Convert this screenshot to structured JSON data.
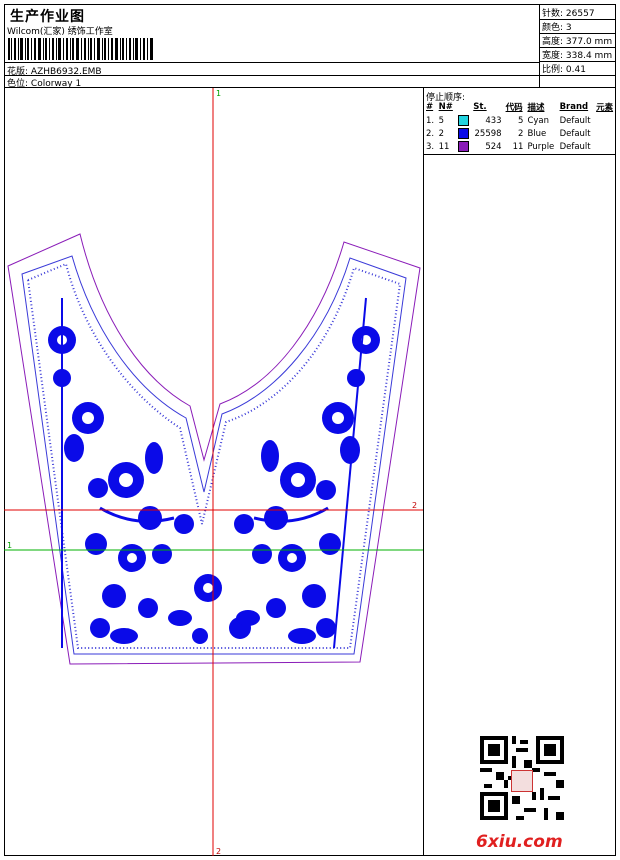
{
  "header": {
    "title": "生产作业图",
    "company": "Wilcom(汇家) 绣饰工作室",
    "design_label": "花版:",
    "design_value": "AZHB6932.EMB",
    "colorway_label": "色位:",
    "colorway_value": "Colorway 1"
  },
  "stats": [
    {
      "label": "针数:",
      "value": "26557"
    },
    {
      "label": "颜色:",
      "value": "3"
    },
    {
      "label": "高度:",
      "value": "377.0 mm"
    },
    {
      "label": "宽度:",
      "value": "338.4 mm"
    },
    {
      "label": "比例:",
      "value": "0.41"
    }
  ],
  "stop_sequence": {
    "title": "停止顺序:",
    "headers": [
      "#",
      "N#",
      "St.",
      "代码",
      "描述",
      "Brand",
      "元素"
    ],
    "rows": [
      {
        "idx": "1.",
        "n": "5",
        "color": "#22d3e0",
        "st": "433",
        "code": "5",
        "desc": "Cyan",
        "brand": "Default"
      },
      {
        "idx": "2.",
        "n": "2",
        "color": "#0a0ae8",
        "st": "25598",
        "code": "2",
        "desc": "Blue",
        "brand": "Default"
      },
      {
        "idx": "3.",
        "n": "11",
        "color": "#8a1cb8",
        "st": "524",
        "code": "11",
        "desc": "Purple",
        "brand": "Default"
      }
    ]
  },
  "guides": {
    "v_top": "1",
    "v_bottom": "2",
    "h_red": "2",
    "h_green": "1"
  },
  "watermark": {
    "text": "6xiu.com"
  },
  "colors": {
    "stitch": "#0a0ae8",
    "outline": "#8a1cb8",
    "red_guide": "#e00000",
    "green_guide": "#00b000"
  }
}
